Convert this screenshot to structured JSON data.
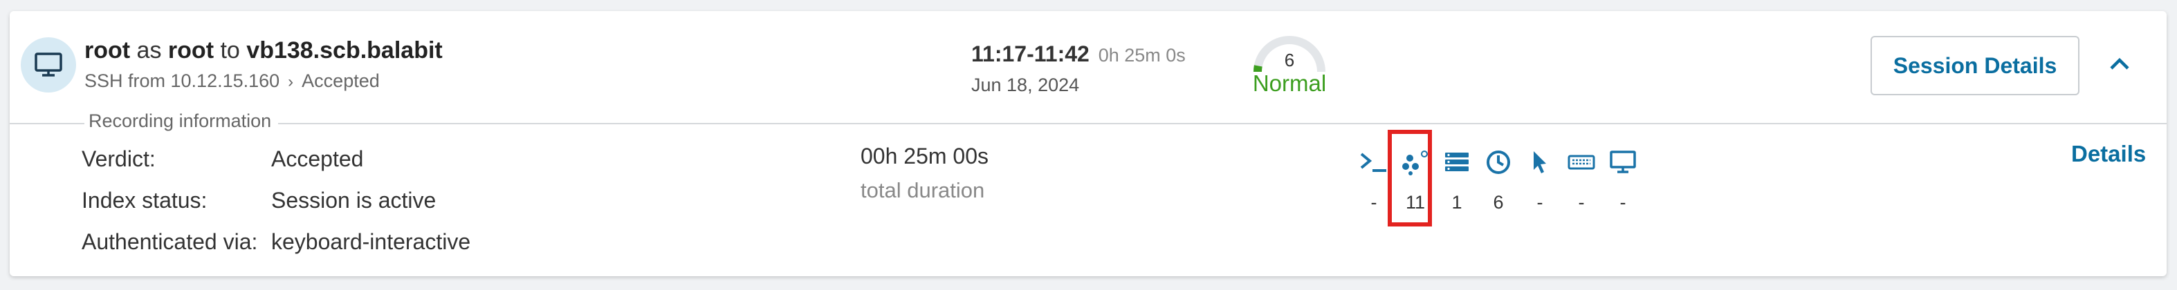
{
  "session": {
    "user": "root",
    "as_word": "as",
    "target_user": "root",
    "to_word": "to",
    "server": "vb138.scb.balabit",
    "protocol_info": "SSH from 10.12.15.160",
    "status": "Accepted",
    "time_range": "11:17-11:42",
    "duration_short": "0h 25m 0s",
    "date": "Jun 18, 2024",
    "gauge_value": "6",
    "gauge_label": "Normal",
    "session_details_button": "Session Details"
  },
  "recording": {
    "section_label": "Recording information",
    "rows": [
      {
        "key": "Verdict:",
        "value": "Accepted"
      },
      {
        "key": "Index status:",
        "value": "Session is active"
      },
      {
        "key": "Authenticated via:",
        "value": "keyboard-interactive"
      }
    ],
    "total_duration": "00h 25m 00s",
    "total_duration_label": "total duration",
    "details_link": "Details"
  },
  "activity_icons": [
    {
      "icon": "terminal-icon",
      "count": "-"
    },
    {
      "icon": "network-icon",
      "count": "11"
    },
    {
      "icon": "list-icon",
      "count": "1"
    },
    {
      "icon": "clock-icon",
      "count": "6"
    },
    {
      "icon": "pointer-icon",
      "count": "-"
    },
    {
      "icon": "keyboard-icon",
      "count": "-"
    },
    {
      "icon": "monitor-icon",
      "count": "-"
    }
  ],
  "colors": {
    "accent": "#0a6ea0",
    "icon": "#1a73a8",
    "normal_green": "#3c9e1f",
    "highlight_red": "#e32320"
  },
  "gauge_fraction": 0.06
}
